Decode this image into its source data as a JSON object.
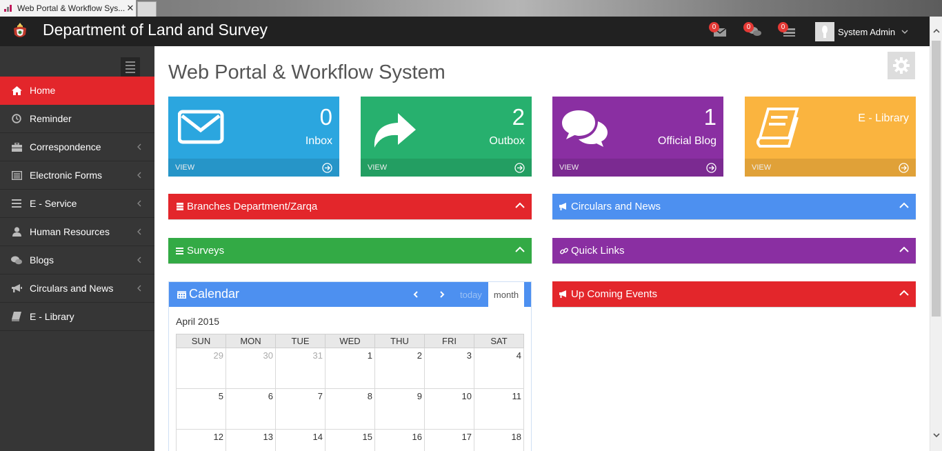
{
  "browser": {
    "tab_title": "Web Portal & Workflow Sys...",
    "close_glyph": "✕"
  },
  "header": {
    "site_title": "Department of Land and Survey",
    "notifications": [
      {
        "icon": "envelope-icon",
        "count": "0"
      },
      {
        "icon": "comments-icon",
        "count": "0"
      },
      {
        "icon": "tasks-icon",
        "count": "0"
      }
    ],
    "user_name": "System Admin"
  },
  "sidebar": {
    "items": [
      {
        "label": "Home",
        "icon": "home-icon",
        "active": true,
        "chevron": false
      },
      {
        "label": "Reminder",
        "icon": "clock-icon",
        "active": false,
        "chevron": false
      },
      {
        "label": "Correspondence",
        "icon": "briefcase-icon",
        "active": false,
        "chevron": true
      },
      {
        "label": "Electronic Forms",
        "icon": "list-alt-icon",
        "active": false,
        "chevron": true
      },
      {
        "label": "E - Service",
        "icon": "bars-icon",
        "active": false,
        "chevron": true
      },
      {
        "label": "Human Resources",
        "icon": "user-icon",
        "active": false,
        "chevron": true
      },
      {
        "label": "Blogs",
        "icon": "comments-icon",
        "active": false,
        "chevron": true
      },
      {
        "label": "Circulars and News",
        "icon": "bullhorn-icon",
        "active": false,
        "chevron": true
      },
      {
        "label": "E - Library",
        "icon": "book-icon",
        "active": false,
        "chevron": false
      }
    ]
  },
  "main": {
    "page_title": "Web Portal & Workflow System",
    "tiles": [
      {
        "count": "0",
        "label": "Inbox",
        "footer": "VIEW",
        "color": "#2ba6df"
      },
      {
        "count": "2",
        "label": "Outbox",
        "footer": "VIEW",
        "color": "#27b06e"
      },
      {
        "count": "1",
        "label": "Official Blog",
        "footer": "VIEW",
        "color": "#8a2fa2"
      },
      {
        "count": "",
        "label": "E - Library",
        "footer": "VIEW",
        "color": "#fab43f"
      }
    ],
    "panels": {
      "branches": {
        "title": "Branches Department/Zarqa",
        "color": "#e3262b"
      },
      "circulars": {
        "title": "Circulars and News",
        "color": "#4d90f0"
      },
      "surveys": {
        "title": "Surveys",
        "color": "#33aa45"
      },
      "quick_links": {
        "title": "Quick Links",
        "color": "#8a2fa2"
      },
      "events": {
        "title": "Up Coming Events",
        "color": "#e3262b"
      }
    },
    "calendar": {
      "title": "Calendar",
      "today_label": "today",
      "month_label": "month",
      "current_month": "April 2015",
      "weekdays": [
        "SUN",
        "MON",
        "TUE",
        "WED",
        "THU",
        "FRI",
        "SAT"
      ],
      "weeks": [
        [
          "29",
          "30",
          "31",
          "1",
          "2",
          "3",
          "4"
        ],
        [
          "5",
          "6",
          "7",
          "8",
          "9",
          "10",
          "11"
        ],
        [
          "12",
          "13",
          "14",
          "15",
          "16",
          "17",
          "18"
        ]
      ]
    }
  }
}
